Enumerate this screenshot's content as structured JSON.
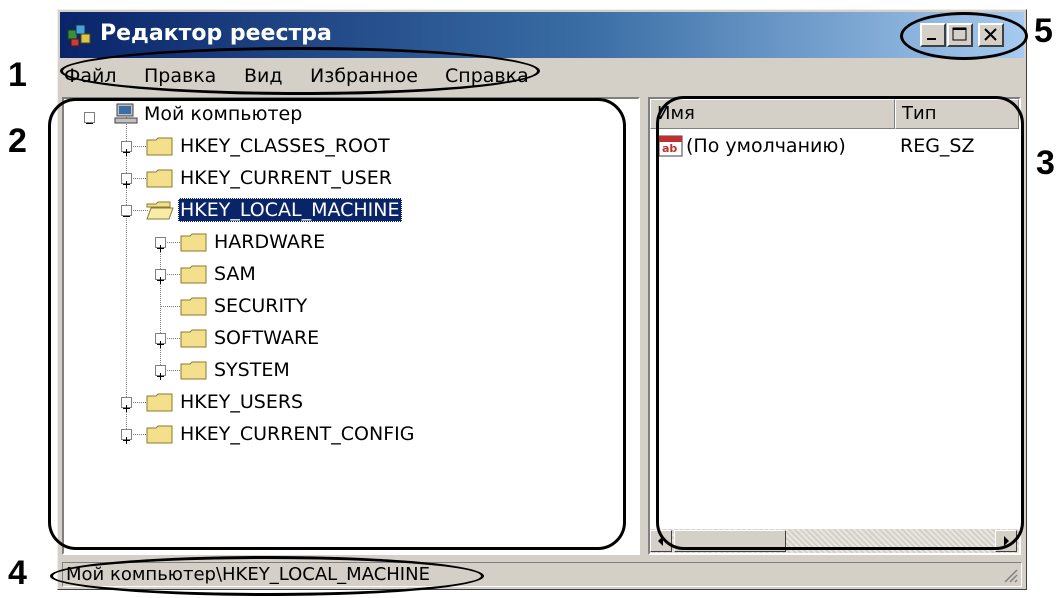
{
  "window": {
    "title": "Редактор реестра"
  },
  "menu": {
    "items": [
      "Файл",
      "Правка",
      "Вид",
      "Избранное",
      "Справка"
    ]
  },
  "tree": {
    "root": "Мой компьютер",
    "hives": [
      {
        "label": "HKEY_CLASSES_ROOT",
        "expander": "plus"
      },
      {
        "label": "HKEY_CURRENT_USER",
        "expander": "plus"
      },
      {
        "label": "HKEY_LOCAL_MACHINE",
        "expander": "minus",
        "selected": true
      },
      {
        "label": "HKEY_USERS",
        "expander": "plus"
      },
      {
        "label": "HKEY_CURRENT_CONFIG",
        "expander": "plus"
      }
    ],
    "children": [
      {
        "label": "HARDWARE",
        "expander": "plus"
      },
      {
        "label": "SAM",
        "expander": "plus"
      },
      {
        "label": "SECURITY",
        "expander": "none"
      },
      {
        "label": "SOFTWARE",
        "expander": "plus"
      },
      {
        "label": "SYSTEM",
        "expander": "plus"
      }
    ]
  },
  "list": {
    "columns": [
      "Имя",
      "Тип"
    ],
    "rows": [
      {
        "name": "(По умолчанию)",
        "type": "REG_SZ",
        "icon": "string-value-icon"
      }
    ]
  },
  "status": {
    "path": "Мой компьютер\\HKEY_LOCAL_MACHINE"
  },
  "callouts": [
    "1",
    "2",
    "3",
    "4",
    "5"
  ],
  "colors": {
    "title_start": "#0a246a",
    "title_end": "#a6caf0",
    "face": "#d4d0c8",
    "selection": "#0a246a",
    "folder": "#f4e08c"
  }
}
